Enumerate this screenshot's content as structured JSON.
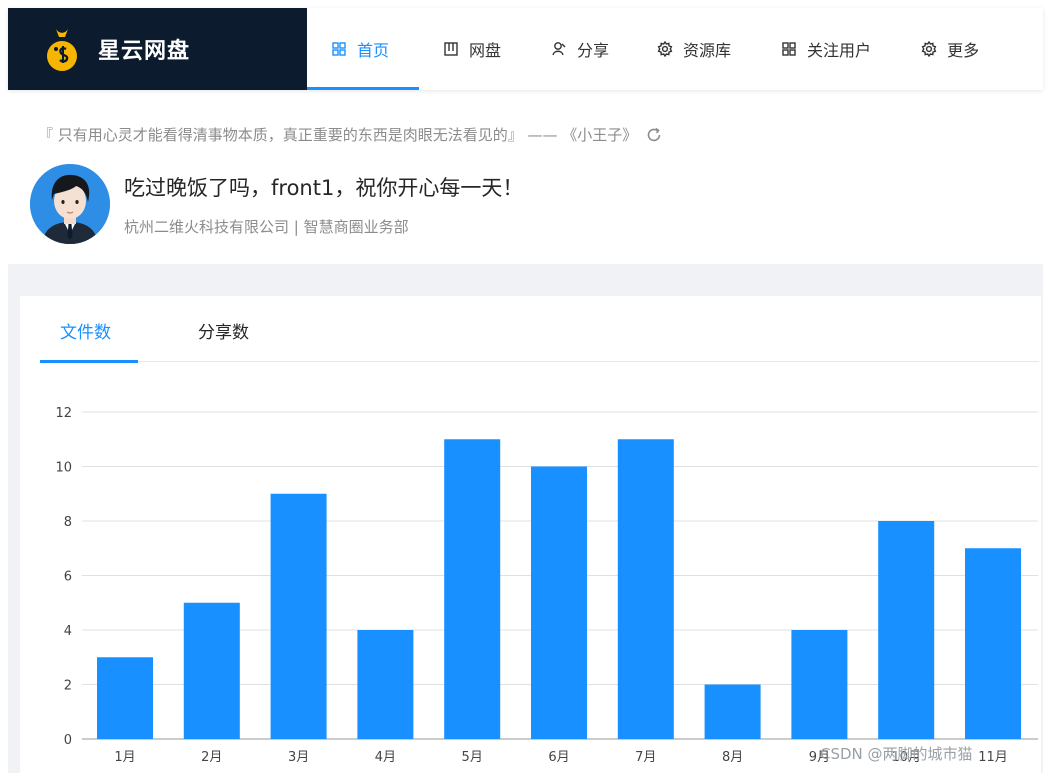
{
  "app": {
    "name": "星云网盘"
  },
  "nav": [
    {
      "label": "首页",
      "icon": "home-grid-icon",
      "active": true
    },
    {
      "label": "网盘",
      "icon": "drive-icon",
      "active": false
    },
    {
      "label": "分享",
      "icon": "share-icon",
      "active": false
    },
    {
      "label": "资源库",
      "icon": "settings-icon",
      "active": false
    },
    {
      "label": "关注用户",
      "icon": "users-grid-icon",
      "active": false
    },
    {
      "label": "更多",
      "icon": "more-settings-icon",
      "active": false
    }
  ],
  "greeting": {
    "quote": "『 只有用心灵才能看得清事物本质，真正重要的东西是肉眼无法看见的』 —— 《小王子》",
    "message": "吃过晚饭了吗，front1，祝你开心每一天！",
    "org": "杭州二维火科技有限公司 | 智慧商圈业务部"
  },
  "tabs": [
    {
      "label": "文件数",
      "active": true
    },
    {
      "label": "分享数",
      "active": false
    }
  ],
  "colors": {
    "accent": "#1890ff",
    "brand_bg": "#0d1b2e"
  },
  "chart_data": {
    "type": "bar",
    "categories": [
      "1月",
      "2月",
      "3月",
      "4月",
      "5月",
      "6月",
      "7月",
      "8月",
      "9月",
      "10月",
      "11月"
    ],
    "values": [
      3,
      5,
      9,
      4,
      11,
      10,
      11,
      2,
      4,
      8,
      7
    ],
    "ylim": [
      0,
      12
    ],
    "yticks": [
      0,
      2,
      4,
      6,
      8,
      10,
      12
    ],
    "grid": true,
    "color": "#1890ff"
  },
  "watermark": "CSDN @两脚的城市猫"
}
